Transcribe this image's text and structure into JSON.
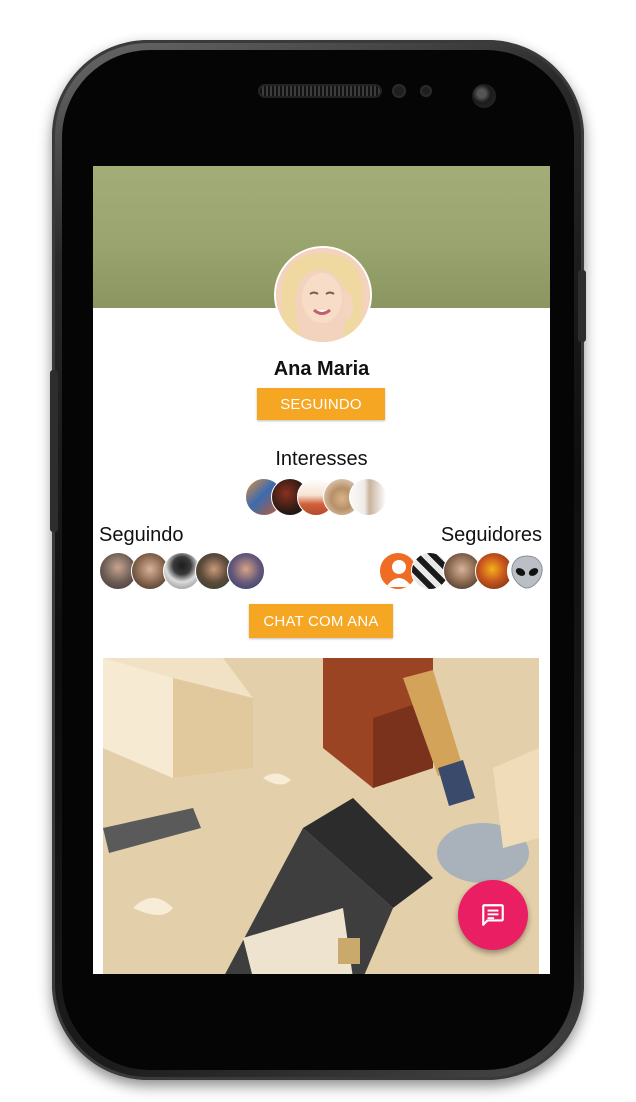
{
  "profile": {
    "name": "Ana Maria",
    "follow_button_label": "SEGUINDO",
    "chat_button_label": "CHAT COM ANA"
  },
  "sections": {
    "interests_title": "Interesses",
    "following_title": "Seguindo",
    "followers_title": "Seguidores"
  },
  "interests": [
    "interest-1",
    "interest-2",
    "interest-3",
    "interest-4",
    "interest-5"
  ],
  "following": [
    "following-1",
    "following-2",
    "following-3",
    "following-4",
    "following-5"
  ],
  "followers": [
    "follower-placeholder",
    "follower-2",
    "follower-3",
    "follower-4",
    "follower-alien"
  ],
  "colors": {
    "accent_orange": "#f5a623",
    "fab_pink": "#e91e63",
    "cover_green": "#9aa46e"
  },
  "icons": {
    "fab": "message-icon",
    "placeholder_user": "person-icon",
    "alien": "alien-emoji-icon"
  }
}
